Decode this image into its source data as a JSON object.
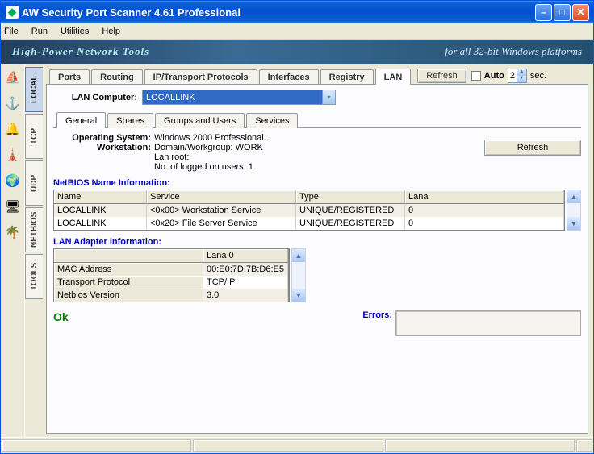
{
  "window": {
    "title": "AW Security Port Scanner 4.61 Professional"
  },
  "menu": {
    "file": "File",
    "run": "Run",
    "utilities": "Utilities",
    "help": "Help"
  },
  "banner": {
    "left": "High-Power Network Tools",
    "right": "for all 32-bit Windows platforms"
  },
  "vtabs": [
    "LOCAL",
    "TCP",
    "UDP",
    "NETBIOS",
    "TOOLS"
  ],
  "activeVtab": 0,
  "topTabs": [
    "Ports",
    "Routing",
    "IP/Transport Protocols",
    "Interfaces",
    "Registry",
    "LAN"
  ],
  "activeTopTab": 5,
  "refreshBtn": "Refresh",
  "auto": {
    "label": "Auto",
    "value": "2",
    "unit": "sec."
  },
  "lanComputer": {
    "label": "LAN Computer:",
    "value": "LOCALLINK"
  },
  "subTabs": [
    "General",
    "Shares",
    "Groups and Users",
    "Services"
  ],
  "activeSubTab": 0,
  "general": {
    "osLabel": "Operating System:",
    "osValue": "Windows 2000 Professional.",
    "wsLabel": "Workstation:",
    "wsLine1": "Domain/Workgroup: WORK",
    "wsLine2": "Lan root:",
    "wsLine3": "No. of logged on users: 1",
    "refreshBtn": "Refresh"
  },
  "netbios": {
    "title": "NetBIOS Name Information:",
    "headers": [
      "Name",
      "Service",
      "Type",
      "Lana"
    ],
    "rows": [
      {
        "name": "LOCALLINK",
        "service": "<0x00> Workstation Service",
        "type": "UNIQUE/REGISTERED",
        "lana": "0"
      },
      {
        "name": "LOCALLINK",
        "service": "<0x20> File Server Service",
        "type": "UNIQUE/REGISTERED",
        "lana": "0"
      }
    ]
  },
  "adapter": {
    "title": "LAN Adapter Information:",
    "colHeader": "Lana 0",
    "rows": [
      {
        "label": "MAC Address",
        "value": "00:E0:7D:7B:D6:E5"
      },
      {
        "label": "Transport Protocol",
        "value": "TCP/IP"
      },
      {
        "label": "Netbios Version",
        "value": "3.0"
      }
    ]
  },
  "status": {
    "ok": "Ok",
    "errorsLabel": "Errors:"
  }
}
